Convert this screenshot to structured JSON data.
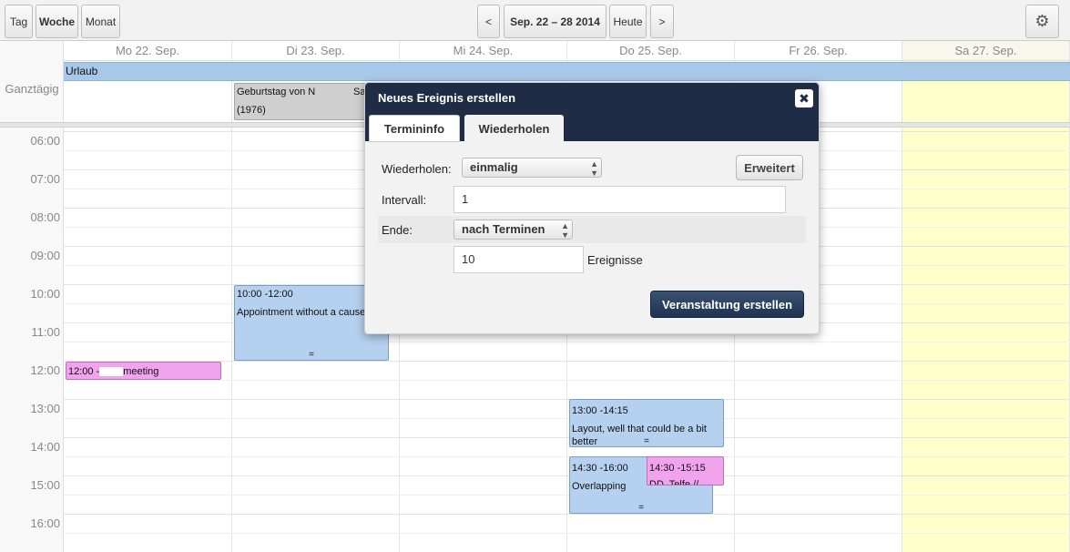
{
  "toolbar": {
    "view_day": "Tag",
    "view_week": "Woche",
    "view_month": "Monat",
    "prev": "<",
    "range": "Sep. 22 – 28 2014",
    "today": "Heute",
    "next": ">",
    "settings_icon": "gear-icon"
  },
  "days": [
    {
      "label": "Mo 22. Sep."
    },
    {
      "label": "Di 23. Sep."
    },
    {
      "label": "Mi 24. Sep."
    },
    {
      "label": "Do 25. Sep."
    },
    {
      "label": "Fr 26. Sep."
    },
    {
      "label": "Sa 27. Sep."
    }
  ],
  "allday": {
    "label": "Ganztägig",
    "band_event": "Urlaub",
    "birthday_title": "Geburtstag von N",
    "birthday_title_right": "Sa",
    "birthday_year": "(1976)"
  },
  "hours": [
    "06:00",
    "07:00",
    "08:00",
    "09:00",
    "10:00",
    "11:00",
    "12:00",
    "13:00",
    "14:00",
    "15:00",
    "16:00"
  ],
  "events": {
    "appointment": {
      "time": "10:00 -12:00",
      "text": "Appointment without a cause"
    },
    "meeting": {
      "time": "12:00 -",
      "text": "meeting"
    },
    "layout": {
      "time": "13:00 -14:15",
      "text": "Layout, well that could be a bit better"
    },
    "overlapping": {
      "time": "14:30 -16:00",
      "text": "Overlapping"
    },
    "dd": {
      "time": "14:30 -15:15",
      "text": "DD. Telfe //"
    },
    "handle": "="
  },
  "modal": {
    "title": "Neues Ereignis erstellen",
    "close": "✖",
    "tab_info": "Termininfo",
    "tab_repeat": "Wiederholen",
    "repeat_label": "Wiederholen:",
    "repeat_value": "einmalig",
    "advanced": "Erweitert",
    "interval_label": "Intervall:",
    "interval_value": "1",
    "end_label": "Ende:",
    "end_value": "nach Terminen",
    "count_value": "10",
    "count_unit": "Ereignisse",
    "create": "Veranstaltung erstellen"
  },
  "colors": {
    "header_dark": "#1e2d45",
    "event_blue": "#b5d1ef",
    "event_pink": "#f1a3ee",
    "saturday_bg": "#ffffcc",
    "allday_band": "#a8c8e8"
  }
}
